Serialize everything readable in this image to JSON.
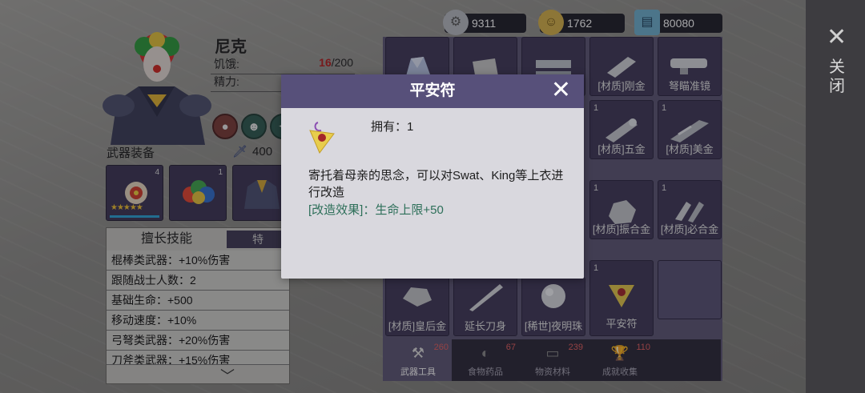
{
  "character": {
    "name": "尼克",
    "hunger_label": "饥饿:",
    "hunger_current": "16",
    "hunger_max": "/200",
    "energy_label": "精力:"
  },
  "weapons": {
    "title": "武器装备",
    "power": "400",
    "slots": [
      {
        "level": "4",
        "stars": "★★★★★"
      },
      {
        "level": "1"
      },
      {
        "level": ""
      }
    ]
  },
  "specialty": {
    "tab_label": "擅长技能",
    "tab2_label": "特",
    "rows": [
      "棍棒类武器：+10%伤害",
      "跟随战士人数：2",
      "基础生命：+500",
      "移动速度：+10%",
      "弓弩类武器：+20%伤害",
      "刀斧类武器：+15%伤害"
    ]
  },
  "currency": [
    {
      "icon": "gear-coin-icon",
      "value": "9311",
      "color": "#b9bcc2"
    },
    {
      "icon": "smiley-coin-icon",
      "value": "1762",
      "color": "#d7b24a"
    },
    {
      "icon": "ticket-icon",
      "value": "80080",
      "color": "#6fb1cf"
    }
  ],
  "inventory": [
    {
      "count": "",
      "label": "",
      "icon": "crystal-icon"
    },
    {
      "count": "",
      "label": "",
      "icon": "cloth-icon"
    },
    {
      "count": "",
      "label": "",
      "icon": "pipe-icon"
    },
    {
      "count": "",
      "label": "[材质]刚金",
      "icon": "metal-bar-icon"
    },
    {
      "count": "",
      "label": "弩瞄准镜",
      "icon": "scope-icon"
    },
    {
      "count": "1",
      "label": "[材质]五金",
      "icon": "hardware-icon"
    },
    {
      "count": "1",
      "label": "[材质]美金",
      "icon": "alloy-icon"
    },
    {
      "count": "1",
      "label": "[材质]振合金",
      "icon": "ore-icon"
    },
    {
      "count": "1",
      "label": "[材质]必合金",
      "icon": "scrap-icon"
    },
    {
      "count": "",
      "label": "[材质]皇后金",
      "icon": "rock-icon"
    },
    {
      "count": "",
      "label": "延长刀身",
      "icon": "blade-icon"
    },
    {
      "count": "",
      "label": "[稀世]夜明珠",
      "icon": "pearl-icon"
    },
    {
      "count": "1",
      "label": "平安符",
      "icon": "amulet-icon"
    }
  ],
  "categories": [
    {
      "label": "武器工具",
      "count": "260"
    },
    {
      "label": "食物药品",
      "count": "67"
    },
    {
      "label": "物资材料",
      "count": "239"
    },
    {
      "label": "成就收集",
      "count": "110"
    }
  ],
  "close": {
    "label": "关闭"
  },
  "modal": {
    "title": "平安符",
    "own_label": "拥有：1",
    "description": "寄托着母亲的思念，可以对Swat、King等上衣进行改造",
    "effect": "[改造效果]：生命上限+50"
  }
}
